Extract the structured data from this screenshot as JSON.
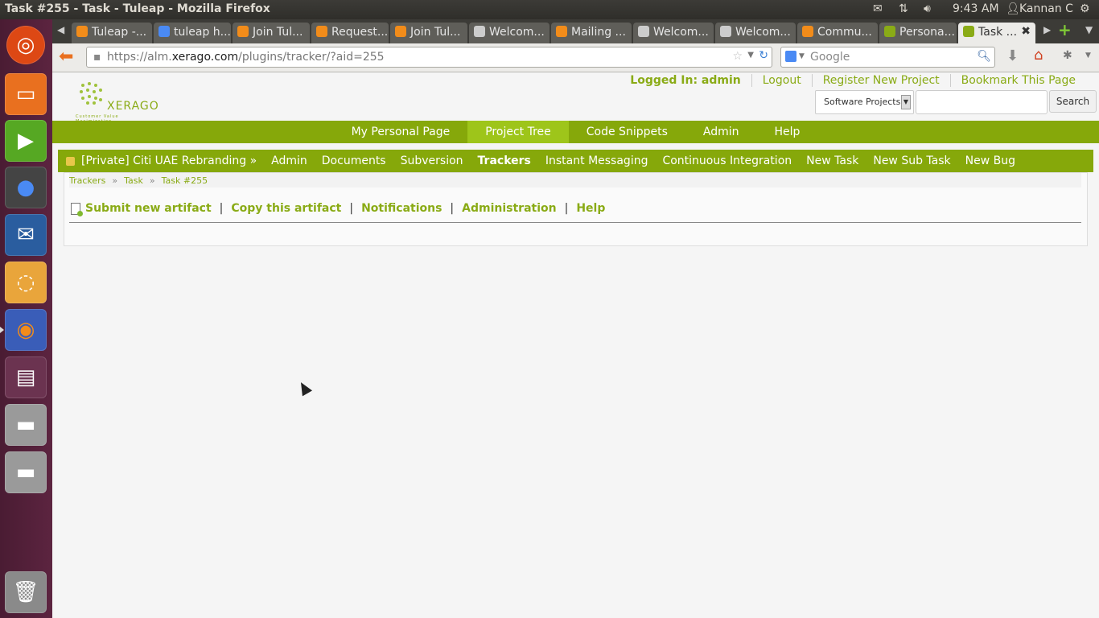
{
  "system": {
    "window_title": "Task #255 - Task - Tuleap - Mozilla Firefox",
    "time": "9:43 AM",
    "user": "Kannan C"
  },
  "browser": {
    "tabs": [
      {
        "label": "Tuleap -...",
        "icon": "firefox-icon"
      },
      {
        "label": "tuleap h...",
        "icon": "google-icon"
      },
      {
        "label": "Join Tul...",
        "icon": "firefox-icon"
      },
      {
        "label": "Request...",
        "icon": "firefox-icon"
      },
      {
        "label": "Join Tul...",
        "icon": "firefox-icon"
      },
      {
        "label": "Welcom...",
        "icon": "doc-icon"
      },
      {
        "label": "Mailing ...",
        "icon": "firefox-icon"
      },
      {
        "label": "Welcom...",
        "icon": "doc-icon"
      },
      {
        "label": "Welcom...",
        "icon": "doc-icon"
      },
      {
        "label": "Commu...",
        "icon": "firefox-icon"
      },
      {
        "label": "Persona...",
        "icon": "xerago-icon"
      },
      {
        "label": "Task ...",
        "icon": "xerago-icon"
      }
    ],
    "url_prefix": "https://alm.",
    "url_domain": "xerago.com",
    "url_path": "/plugins/tracker/?aid=255",
    "search_placeholder": "Google"
  },
  "header": {
    "logo_text": "XERAGO",
    "logo_tagline": "Customer Value Maximization",
    "logged_in": "Logged In: admin",
    "logout": "Logout",
    "register": "Register New Project",
    "bookmark": "Bookmark This Page",
    "search_scope": "Software Projects",
    "search_button": "Search"
  },
  "main_nav": [
    "My Personal Page",
    "Project Tree",
    "Code Snippets",
    "Admin",
    "Help"
  ],
  "project_nav": {
    "project": "[Private] Citi UAE Rebranding »",
    "items": [
      "Admin",
      "Documents",
      "Subversion",
      "Trackers",
      "Instant Messaging",
      "Continuous Integration",
      "New Task",
      "New Sub Task",
      "New Bug"
    ]
  },
  "breadcrumb": [
    "Trackers",
    "Task",
    "Task #255"
  ],
  "actions": [
    "Submit new artifact",
    "Copy this artifact",
    "Notifications",
    "Administration",
    "Help"
  ]
}
